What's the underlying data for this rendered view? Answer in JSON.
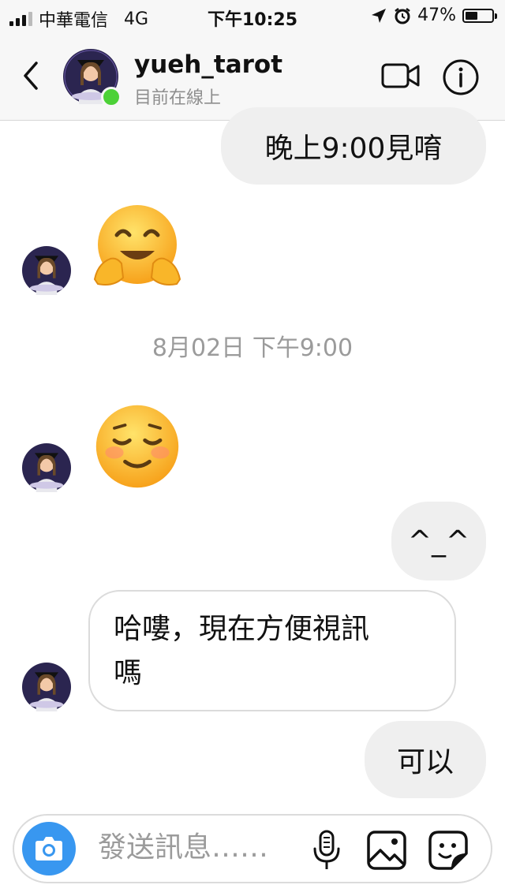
{
  "status_bar": {
    "carrier": "中華電信",
    "network": "4G",
    "time": "下午10:25",
    "battery": "47%",
    "battery_level": 0.47,
    "signal_bars": 3
  },
  "header": {
    "username": "yueh_tarot",
    "presence": "目前在線上",
    "icons": {
      "back": "chevron-left-icon",
      "video": "video-camera-icon",
      "info": "info-icon"
    }
  },
  "messages": [
    {
      "direction": "out",
      "type": "text",
      "text": "晚上9:00見唷"
    },
    {
      "direction": "in",
      "type": "emoji",
      "emoji": "hugging-face"
    },
    {
      "type": "timestamp",
      "text": "8月02日 下午9:00"
    },
    {
      "direction": "in",
      "type": "emoji",
      "emoji": "smiling-face-blushing"
    },
    {
      "direction": "out",
      "type": "text",
      "text": "^_^"
    },
    {
      "direction": "in",
      "type": "text",
      "line1": "哈嘍，現在方便視訊",
      "line2": "嗎"
    },
    {
      "direction": "out",
      "type": "text",
      "text": "可以"
    }
  ],
  "composer": {
    "placeholder": "發送訊息……",
    "icons": {
      "camera": "camera-icon",
      "mic": "microphone-icon",
      "gallery": "image-icon",
      "sticker": "sticker-icon"
    }
  },
  "colors": {
    "online": "#4cd137",
    "camera_button": "#3897f0",
    "outgoing_bubble": "#efefef",
    "incoming_border": "#dbdbdb",
    "secondary_text": "#9b9b9b"
  }
}
